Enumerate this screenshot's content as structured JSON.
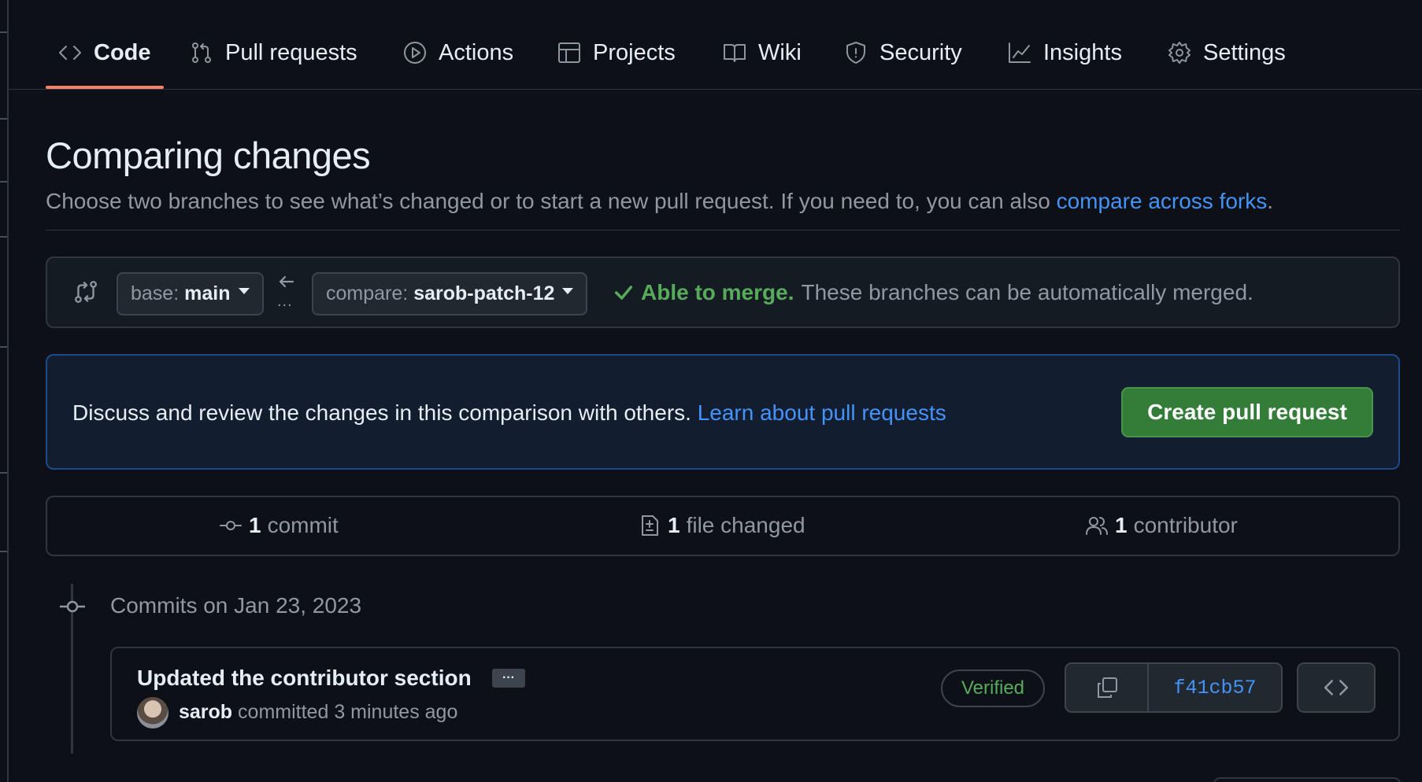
{
  "nav": {
    "items": [
      {
        "label": "Code",
        "icon": "code-icon",
        "active": true
      },
      {
        "label": "Pull requests",
        "icon": "git-pull-request-icon"
      },
      {
        "label": "Actions",
        "icon": "play-icon"
      },
      {
        "label": "Projects",
        "icon": "table-icon"
      },
      {
        "label": "Wiki",
        "icon": "book-icon"
      },
      {
        "label": "Security",
        "icon": "shield-icon"
      },
      {
        "label": "Insights",
        "icon": "graph-icon"
      },
      {
        "label": "Settings",
        "icon": "gear-icon"
      }
    ],
    "active_underline_color": "#f78166"
  },
  "page": {
    "title": "Comparing changes",
    "subtitle_prefix": "Choose two branches to see what’s changed or to start a new pull request. If you need to, you can also ",
    "subtitle_link": "compare across forks",
    "subtitle_suffix": "."
  },
  "range": {
    "base_prefix": "base:",
    "base_branch": "main",
    "compare_prefix": "compare:",
    "compare_branch": "sarob-patch-12",
    "arrow_dots": "...",
    "merge_status_strong": "Able to merge.",
    "merge_status_text": "These branches can be automatically merged."
  },
  "flash": {
    "text": "Discuss and review the changes in this comparison with others.",
    "link": "Learn about pull requests",
    "button": "Create pull request"
  },
  "summary": {
    "commits_count": "1",
    "commits_label": "commit",
    "files_count": "1",
    "files_label": "file changed",
    "contributors_count": "1",
    "contributors_label": "contributor"
  },
  "commits": {
    "date_heading": "Commits on Jan 23, 2023",
    "items": [
      {
        "title": "Updated the contributor section",
        "ellipsis": "···",
        "author": "sarob",
        "action": "committed",
        "time": "3 minutes ago",
        "verified": "Verified",
        "sha": "f41cb57"
      }
    ]
  },
  "colors": {
    "background": "#0d1117",
    "accent_link": "#4493f8",
    "success": "#57ab5a",
    "primary_button": "#347d39"
  }
}
